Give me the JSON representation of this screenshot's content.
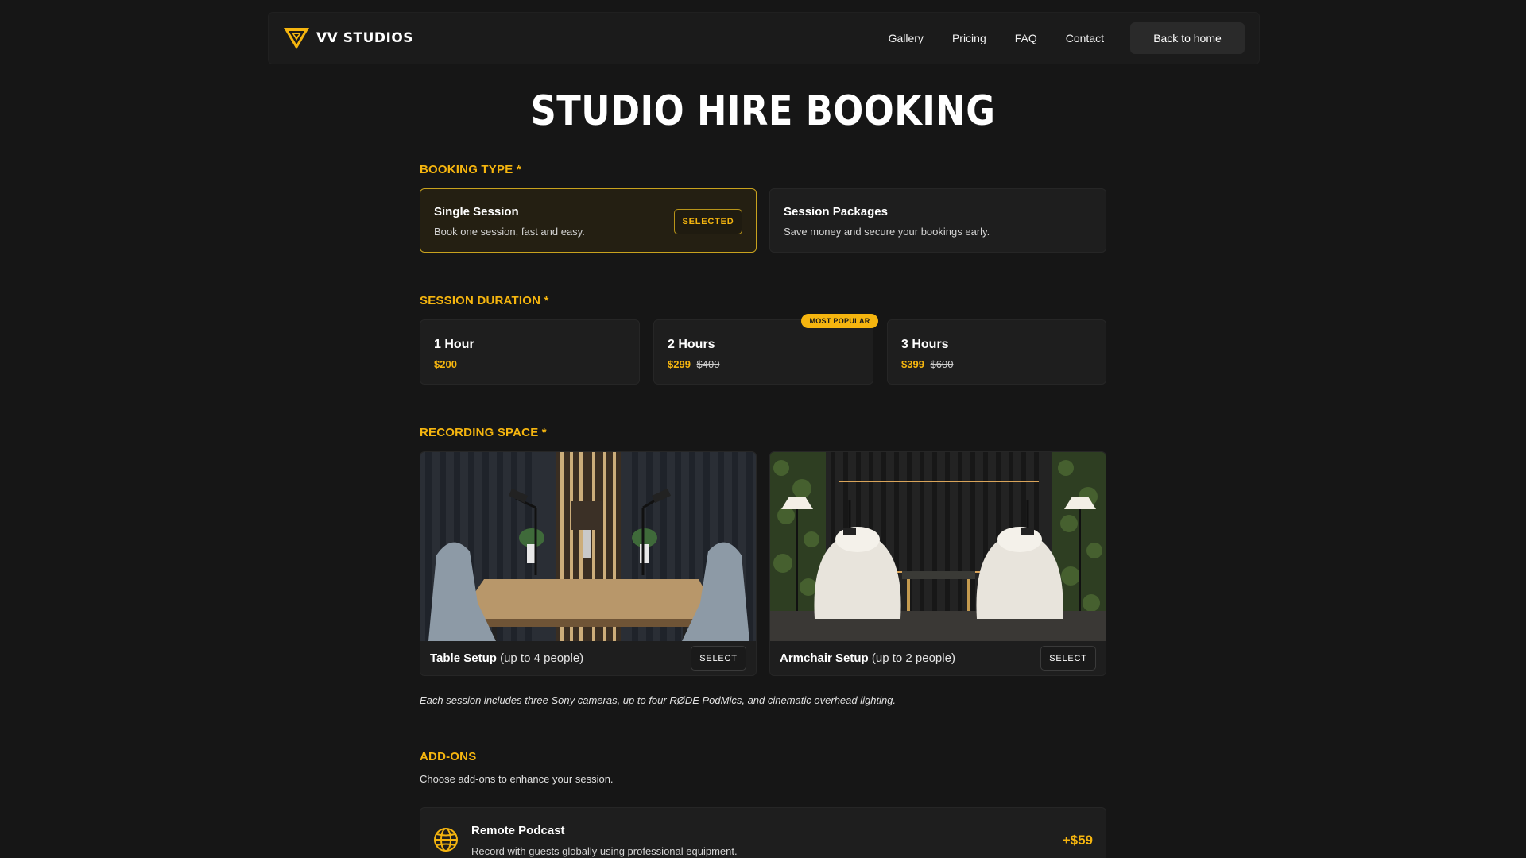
{
  "brand": {
    "name": "VV STUDIOS",
    "logo_icon": "vv-logo-icon",
    "accent": "#f5b50f"
  },
  "nav": {
    "links": [
      "Gallery",
      "Pricing",
      "FAQ",
      "Contact"
    ],
    "back_button": "Back to home"
  },
  "page": {
    "title": "STUDIO HIRE BOOKING"
  },
  "booking_type": {
    "label": "BOOKING TYPE *",
    "options": [
      {
        "title": "Single Session",
        "description": "Book one session, fast and easy.",
        "badge": "SELECTED"
      },
      {
        "title": "Session Packages",
        "description": "Save money and secure your bookings early."
      }
    ]
  },
  "session_duration": {
    "label": "SESSION DURATION *",
    "badge": "MOST POPULAR",
    "options": [
      {
        "title": "1 Hour",
        "price": "$200",
        "original_price": ""
      },
      {
        "title": "2 Hours",
        "price": "$299",
        "original_price": "$400"
      },
      {
        "title": "3 Hours",
        "price": "$399",
        "original_price": "$600"
      }
    ]
  },
  "recording_space": {
    "label": "RECORDING SPACE *",
    "options": [
      {
        "name": "Table Setup",
        "capacity": "(up to 4 people)",
        "button": "SELECT"
      },
      {
        "name": "Armchair Setup",
        "capacity": "(up to 2 people)",
        "button": "SELECT"
      }
    ],
    "note": "Each session includes three Sony cameras, up to four RØDE PodMics, and cinematic overhead lighting."
  },
  "addons": {
    "label": "ADD-ONS",
    "subtitle": "Choose add-ons to enhance your session.",
    "items": [
      {
        "title": "Remote Podcast",
        "description": "Record with guests globally using professional equipment.",
        "price": "+$59",
        "icon": "globe-icon"
      }
    ]
  }
}
